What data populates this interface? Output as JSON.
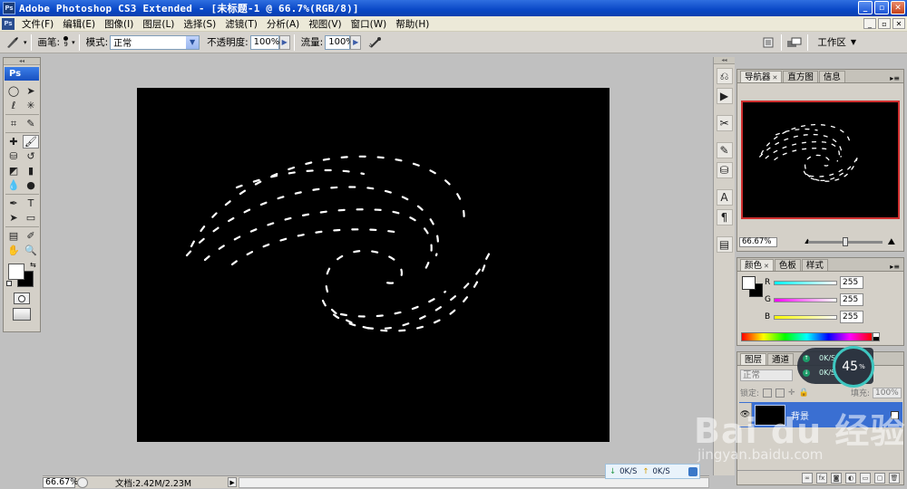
{
  "app": {
    "title": "Adobe Photoshop CS3 Extended - [未标题-1 @ 66.7%(RGB/8)]",
    "logo": "Ps"
  },
  "window_controls": [
    "_",
    "▫",
    "✕"
  ],
  "menu": [
    "文件(F)",
    "编辑(E)",
    "图像(I)",
    "图层(L)",
    "选择(S)",
    "滤镜(T)",
    "分析(A)",
    "视图(V)",
    "窗口(W)",
    "帮助(H)"
  ],
  "options": {
    "brush_label": "画笔:",
    "brush_size": "9",
    "mode_label": "模式:",
    "mode_value": "正常",
    "opacity_label": "不透明度:",
    "opacity_value": "100%",
    "flow_label": "流量:",
    "flow_value": "100%",
    "workspace_label": "工作区"
  },
  "toolbox": {
    "badge": "Ps",
    "tools": [
      "marquee-tool",
      "move-tool",
      "lasso-tool",
      "magic-wand-tool",
      "crop-tool",
      "slice-tool",
      "healing-brush-tool",
      "brush-tool",
      "clone-stamp-tool",
      "history-brush-tool",
      "eraser-tool",
      "gradient-tool",
      "blur-tool",
      "dodge-tool",
      "pen-tool",
      "type-tool",
      "path-selection-tool",
      "shape-tool",
      "notes-tool",
      "eyedropper-tool",
      "hand-tool",
      "zoom-tool"
    ],
    "tool_glyphs": [
      "◯",
      "➤",
      "ℓ",
      "✳",
      "⌗",
      "✎",
      "✚",
      "🖌",
      "⛁",
      "↺",
      "◩",
      "▮",
      "💧",
      "●",
      "✒",
      "T",
      "➤",
      "▭",
      "▤",
      "✐",
      "✋",
      "🔍"
    ],
    "selected_tool": "brush-tool",
    "foreground_color": "#ffffff",
    "background_color": "#000000"
  },
  "status": {
    "zoom": "66.67%",
    "doc_info": "文档:2.42M/2.23M"
  },
  "panels": {
    "navigator": {
      "tabs": [
        "导航器",
        "直方图",
        "信息"
      ],
      "zoom": "66.67%"
    },
    "color": {
      "tabs": [
        "颜色",
        "色板",
        "样式"
      ],
      "channels": [
        {
          "label": "R",
          "value": "255",
          "gradient": "#00ffff"
        },
        {
          "label": "G",
          "value": "255",
          "gradient": "#ff00ff"
        },
        {
          "label": "B",
          "value": "255",
          "gradient": "#ffff00"
        }
      ]
    },
    "layers": {
      "tabs": [
        "图层",
        "通道"
      ],
      "blend_mode": "正常",
      "lock_label": "锁定:",
      "fill_label": "填充:",
      "fill_value": "100%",
      "layer_name": "背景"
    }
  },
  "network": {
    "down": "0K/S",
    "up": "0K/S",
    "gauge": "45",
    "gauge_unit": "%"
  },
  "watermark": {
    "main": "Bai du 经验",
    "sub": "jingyan.baidu.com"
  }
}
